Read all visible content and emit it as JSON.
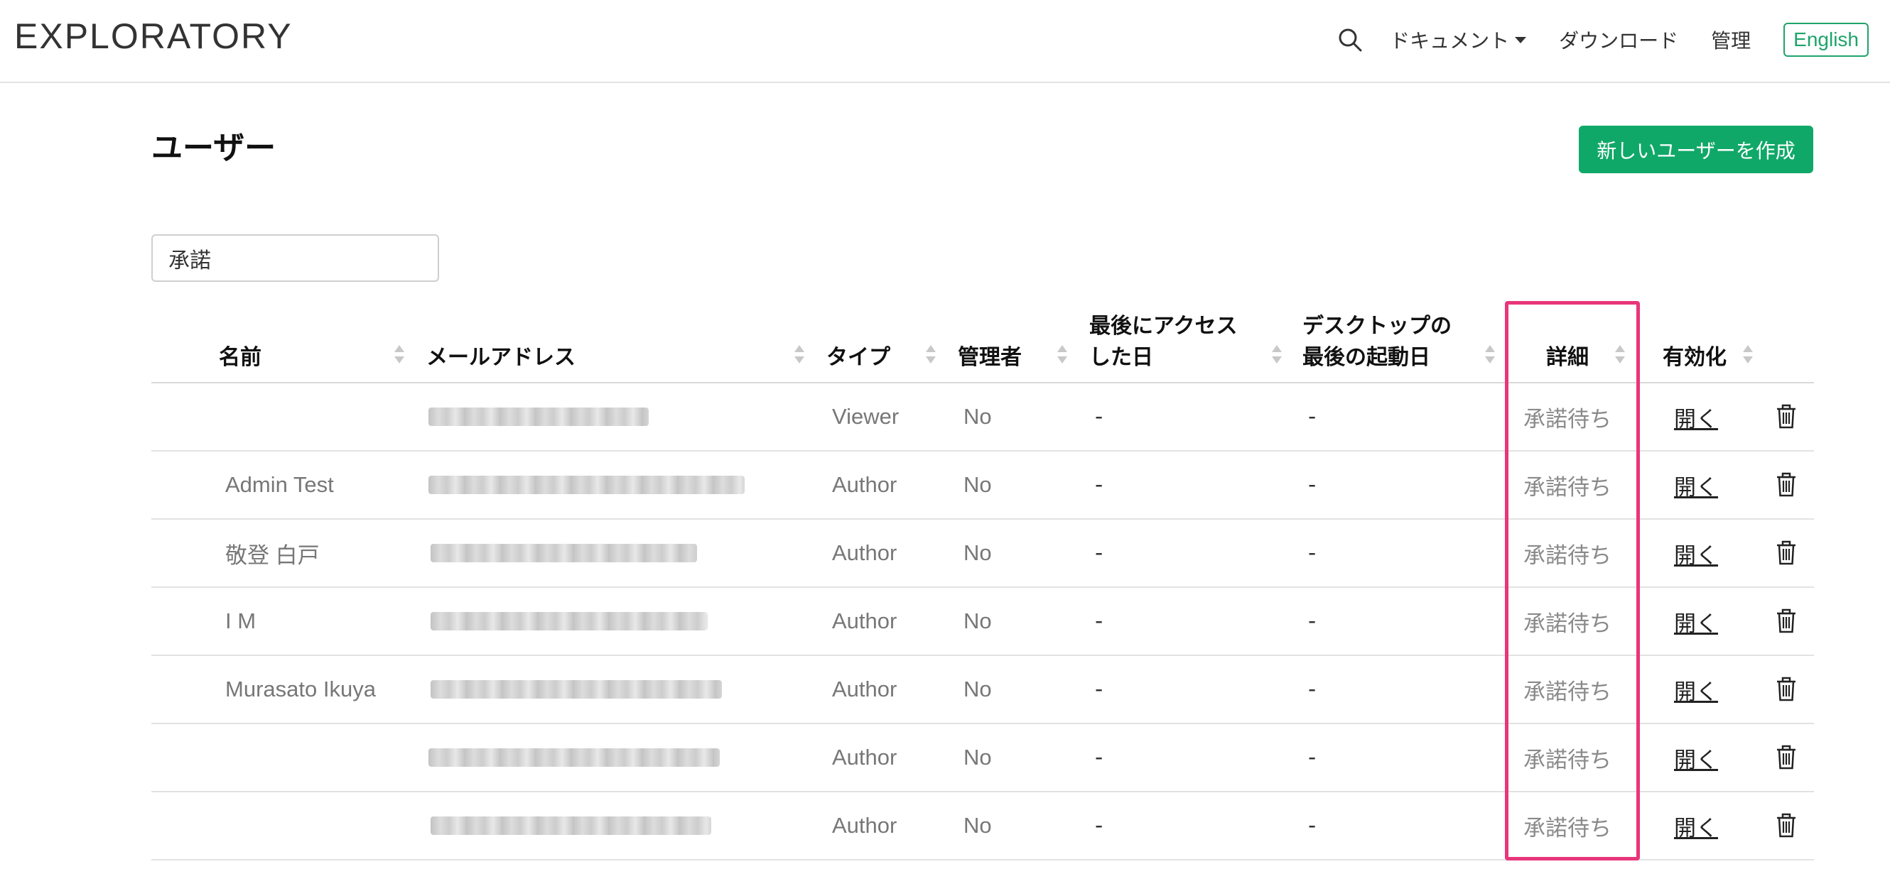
{
  "header": {
    "logo": "EXPLORATORY",
    "nav": {
      "documents": "ドキュメント",
      "download": "ダウンロード",
      "admin": "管理",
      "language": "English"
    }
  },
  "page": {
    "title": "ユーザー",
    "create_button": "新しいユーザーを作成",
    "filter_value": "承諾"
  },
  "table": {
    "columns": {
      "name": "名前",
      "email": "メールアドレス",
      "type": "タイプ",
      "admin": "管理者",
      "last_access_1": "最後にアクセス",
      "last_access_2": "した日",
      "desktop_1": "デスクトップの",
      "desktop_2": "最後の起動日",
      "details": "詳細",
      "activate": "有効化"
    },
    "rows": [
      {
        "name": "",
        "type": "Viewer",
        "admin": "No",
        "last_access": "-",
        "desktop": "-",
        "details": "承諾待ち",
        "activate": "開く"
      },
      {
        "name": "Admin Test",
        "type": "Author",
        "admin": "No",
        "last_access": "-",
        "desktop": "-",
        "details": "承諾待ち",
        "activate": "開く"
      },
      {
        "name": "敬登 白戸",
        "type": "Author",
        "admin": "No",
        "last_access": "-",
        "desktop": "-",
        "details": "承諾待ち",
        "activate": "開く"
      },
      {
        "name": "I M",
        "type": "Author",
        "admin": "No",
        "last_access": "-",
        "desktop": "-",
        "details": "承諾待ち",
        "activate": "開く"
      },
      {
        "name": "Murasato Ikuya",
        "type": "Author",
        "admin": "No",
        "last_access": "-",
        "desktop": "-",
        "details": "承諾待ち",
        "activate": "開く"
      },
      {
        "name": "",
        "type": "Author",
        "admin": "No",
        "last_access": "-",
        "desktop": "-",
        "details": "承諾待ち",
        "activate": "開く"
      },
      {
        "name": "",
        "type": "Author",
        "admin": "No",
        "last_access": "-",
        "desktop": "-",
        "details": "承諾待ち",
        "activate": "開く"
      }
    ]
  },
  "colors": {
    "brand_green": "#10a868",
    "highlight": "#e8367a"
  }
}
